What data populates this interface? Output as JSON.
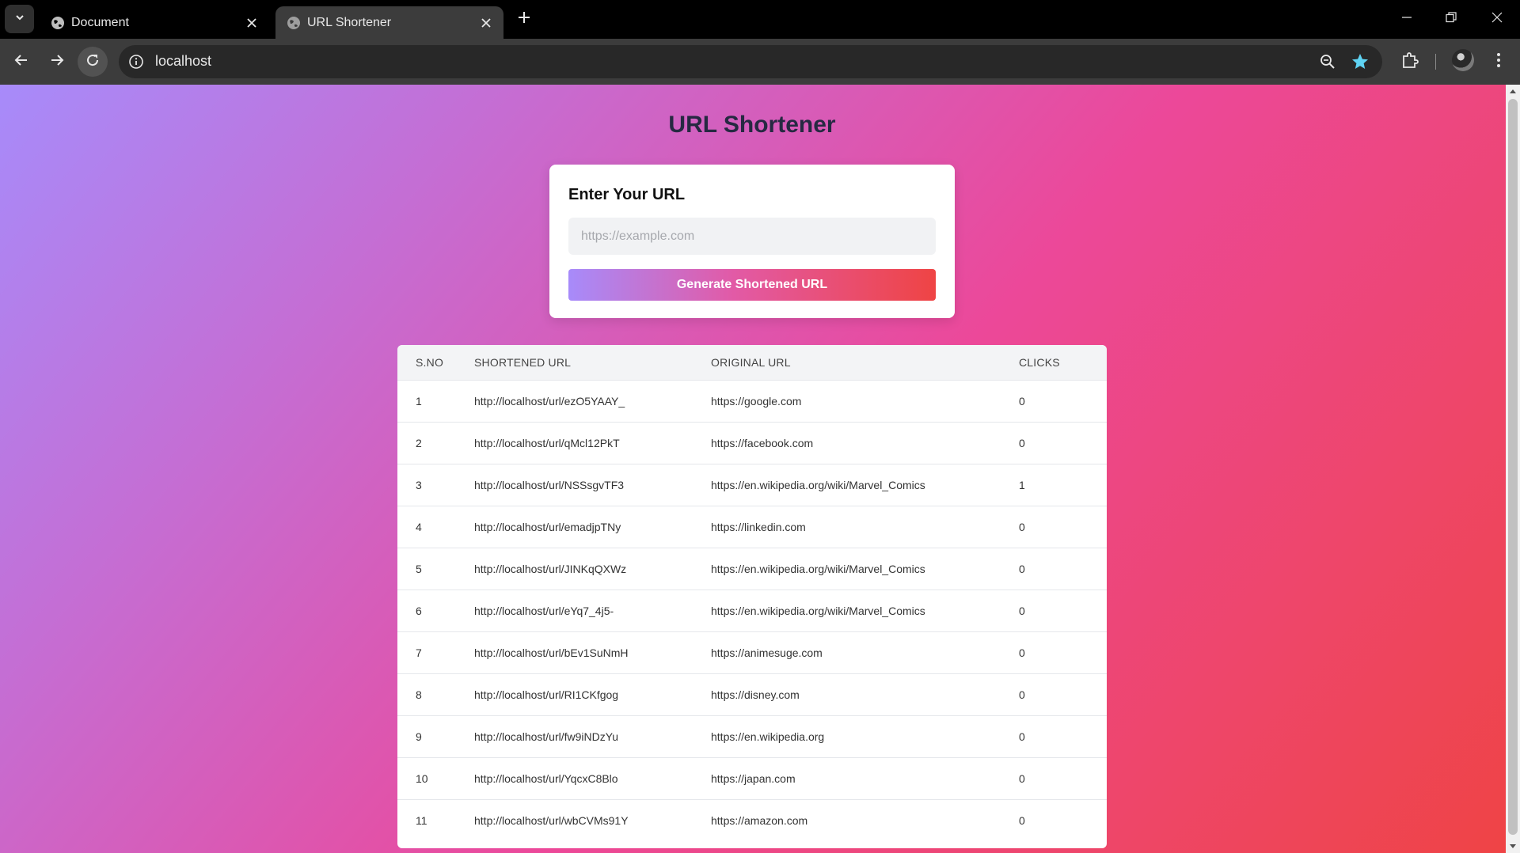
{
  "browser": {
    "tabs": [
      {
        "title": "Document",
        "active": false
      },
      {
        "title": "URL Shortener",
        "active": true
      }
    ],
    "address": "localhost",
    "accent_color": "#5fd3f3"
  },
  "page": {
    "title": "URL Shortener",
    "form": {
      "heading": "Enter Your URL",
      "input_value": "",
      "input_placeholder": "https://example.com",
      "button_label": "Generate Shortened URL"
    },
    "table": {
      "headers": [
        "S.NO",
        "SHORTENED URL",
        "ORIGINAL URL",
        "CLICKS"
      ],
      "rows": [
        [
          "1",
          "http://localhost/url/ezO5YAAY_",
          "https://google.com",
          "0"
        ],
        [
          "2",
          "http://localhost/url/qMcl12PkT",
          "https://facebook.com",
          "0"
        ],
        [
          "3",
          "http://localhost/url/NSSsgvTF3",
          "https://en.wikipedia.org/wiki/Marvel_Comics",
          "1"
        ],
        [
          "4",
          "http://localhost/url/emadjpTNy",
          "https://linkedin.com",
          "0"
        ],
        [
          "5",
          "http://localhost/url/JINKqQXWz",
          "https://en.wikipedia.org/wiki/Marvel_Comics",
          "0"
        ],
        [
          "6",
          "http://localhost/url/eYq7_4j5-",
          "https://en.wikipedia.org/wiki/Marvel_Comics",
          "0"
        ],
        [
          "7",
          "http://localhost/url/bEv1SuNmH",
          "https://animesuge.com",
          "0"
        ],
        [
          "8",
          "http://localhost/url/RI1CKfgog",
          "https://disney.com",
          "0"
        ],
        [
          "9",
          "http://localhost/url/fw9iNDzYu",
          "https://en.wikipedia.org",
          "0"
        ],
        [
          "10",
          "http://localhost/url/YqcxC8Blo",
          "https://japan.com",
          "0"
        ],
        [
          "11",
          "http://localhost/url/wbCVMs91Y",
          "https://amazon.com",
          "0"
        ]
      ]
    }
  }
}
